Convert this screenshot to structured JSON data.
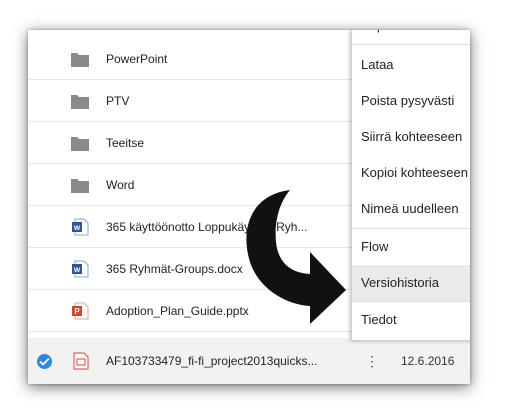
{
  "files": [
    {
      "name": "PowerPoint",
      "icon": "folder-icon"
    },
    {
      "name": "PTV",
      "icon": "folder-icon"
    },
    {
      "name": "Teeitse",
      "icon": "folder-icon"
    },
    {
      "name": "Word",
      "icon": "folder-icon"
    },
    {
      "name": "365 käyttöönotto Loppukäyttäjä Ryh...",
      "icon": "word-doc-icon"
    },
    {
      "name": "365 Ryhmät-Groups.docx",
      "icon": "word-doc-icon"
    },
    {
      "name": "Adoption_Plan_Guide.pptx",
      "icon": "powerpoint-doc-icon"
    }
  ],
  "selected_file": {
    "name": "AF103733479_fi-fi_project2013quicks...",
    "icon": "powerpoint-doc-icon",
    "more_label": "⋮",
    "date": "12.6.2016"
  },
  "context_menu": {
    "partial_top_label": "Kopioi linkki",
    "items": [
      {
        "label": "Lataa"
      },
      {
        "label": "Poista pysyvästi"
      },
      {
        "label": "Siirrä kohteeseen"
      },
      {
        "label": "Kopioi kohteeseen"
      },
      {
        "label": "Nimeä uudelleen"
      },
      {
        "label": "Flow"
      },
      {
        "label": "Versiohistoria",
        "highlighted": true
      },
      {
        "label": "Tiedot"
      }
    ]
  },
  "colors": {
    "folder": "#8a8a8a",
    "word": "#2b579a",
    "powerpoint": "#d24726",
    "accent_check": "#2b87e0",
    "arrow": "#111111"
  }
}
